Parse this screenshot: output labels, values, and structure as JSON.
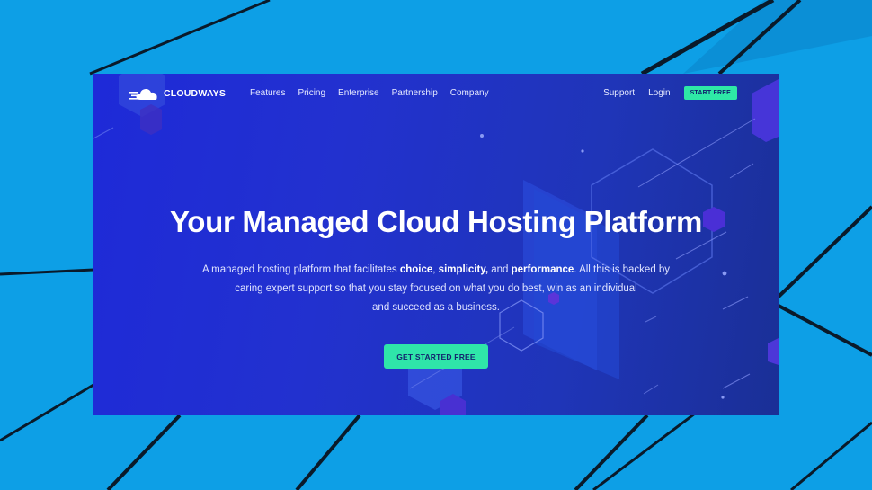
{
  "nav": {
    "brand": "CLOUDWAYS",
    "links": [
      "Features",
      "Pricing",
      "Enterprise",
      "Partnership",
      "Company"
    ],
    "support": "Support",
    "login": "Login",
    "start_free": "START FREE"
  },
  "hero": {
    "title": "Your Managed Cloud Hosting Platform",
    "sub_line1_a": "A managed hosting platform that facilitates ",
    "sub_choice": "choice",
    "sub_comma1": ", ",
    "sub_simplicity": "simplicity,",
    "sub_and": " and ",
    "sub_performance": "performance",
    "sub_line1_b": ". All this is backed by",
    "sub_line2": "caring expert support so that you stay focused on what you do best, win as an individual",
    "sub_line3": "and succeed as a business.",
    "cta": "GET STARTED FREE"
  },
  "colors": {
    "desktop_bg": "#0d9fe6",
    "hero_bg": "#2231cf",
    "accent": "#2ee8a6"
  }
}
